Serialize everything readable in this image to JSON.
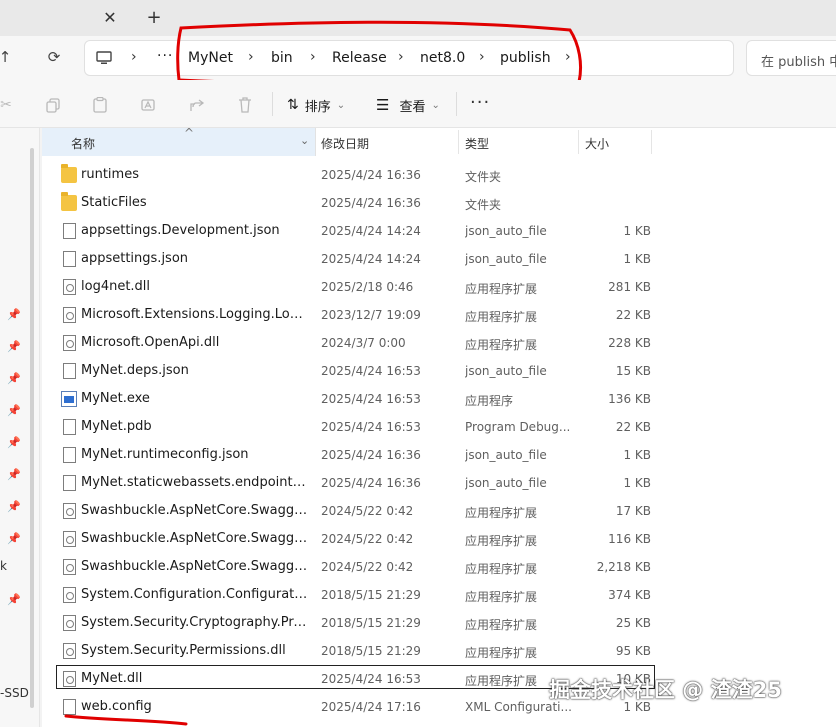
{
  "tabstrip": {
    "close_glyph": "✕",
    "new_tab_glyph": "+"
  },
  "address": {
    "crumbs": [
      "MyNet",
      "bin",
      "Release",
      "net8.0",
      "publish"
    ],
    "more_glyph": "···",
    "search_placeholder": "在 publish 中"
  },
  "commandbar": {
    "sort_label": "排序",
    "view_label": "查看",
    "more_glyph": "···"
  },
  "navpane": {
    "fragment_k": "k",
    "fragment_ssd": "-SSD"
  },
  "columns": {
    "name": "名称",
    "modified": "修改日期",
    "type": "类型",
    "size": "大小"
  },
  "files": [
    {
      "name": "runtimes",
      "date": "2025/4/24 16:36",
      "type": "文件夹",
      "size": "",
      "icon": "folder-icon"
    },
    {
      "name": "StaticFiles",
      "date": "2025/4/24 16:36",
      "type": "文件夹",
      "size": "",
      "icon": "folder-icon"
    },
    {
      "name": "appsettings.Development.json",
      "date": "2025/4/24 14:24",
      "type": "json_auto_file",
      "size": "1 KB",
      "icon": "file-icon"
    },
    {
      "name": "appsettings.json",
      "date": "2025/4/24 14:24",
      "type": "json_auto_file",
      "size": "1 KB",
      "icon": "file-icon"
    },
    {
      "name": "log4net.dll",
      "date": "2025/2/18 0:46",
      "type": "应用程序扩展",
      "size": "281 KB",
      "icon": "dll-icon"
    },
    {
      "name": "Microsoft.Extensions.Logging.Log4N...",
      "date": "2023/12/7 19:09",
      "type": "应用程序扩展",
      "size": "22 KB",
      "icon": "dll-icon"
    },
    {
      "name": "Microsoft.OpenApi.dll",
      "date": "2024/3/7 0:00",
      "type": "应用程序扩展",
      "size": "228 KB",
      "icon": "dll-icon"
    },
    {
      "name": "MyNet.deps.json",
      "date": "2025/4/24 16:53",
      "type": "json_auto_file",
      "size": "15 KB",
      "icon": "file-icon"
    },
    {
      "name": "MyNet.exe",
      "date": "2025/4/24 16:53",
      "type": "应用程序",
      "size": "136 KB",
      "icon": "exe-icon"
    },
    {
      "name": "MyNet.pdb",
      "date": "2025/4/24 16:53",
      "type": "Program Debug...",
      "size": "22 KB",
      "icon": "file-icon"
    },
    {
      "name": "MyNet.runtimeconfig.json",
      "date": "2025/4/24 16:36",
      "type": "json_auto_file",
      "size": "1 KB",
      "icon": "file-icon"
    },
    {
      "name": "MyNet.staticwebassets.endpoints.json",
      "date": "2025/4/24 16:36",
      "type": "json_auto_file",
      "size": "1 KB",
      "icon": "file-icon"
    },
    {
      "name": "Swashbuckle.AspNetCore.Swagger.dll",
      "date": "2024/5/22 0:42",
      "type": "应用程序扩展",
      "size": "17 KB",
      "icon": "dll-icon"
    },
    {
      "name": "Swashbuckle.AspNetCore.SwaggerG...",
      "date": "2024/5/22 0:42",
      "type": "应用程序扩展",
      "size": "116 KB",
      "icon": "dll-icon"
    },
    {
      "name": "Swashbuckle.AspNetCore.SwaggerUI...",
      "date": "2024/5/22 0:42",
      "type": "应用程序扩展",
      "size": "2,218 KB",
      "icon": "dll-icon"
    },
    {
      "name": "System.Configuration.ConfigurationM...",
      "date": "2018/5/15 21:29",
      "type": "应用程序扩展",
      "size": "374 KB",
      "icon": "dll-icon"
    },
    {
      "name": "System.Security.Cryptography.Protect...",
      "date": "2018/5/15 21:29",
      "type": "应用程序扩展",
      "size": "25 KB",
      "icon": "dll-icon"
    },
    {
      "name": "System.Security.Permissions.dll",
      "date": "2018/5/15 21:29",
      "type": "应用程序扩展",
      "size": "95 KB",
      "icon": "dll-icon"
    },
    {
      "name": "MyNet.dll",
      "date": "2025/4/24 16:53",
      "type": "应用程序扩展",
      "size": "10 KB",
      "icon": "dll-icon",
      "selected": true
    },
    {
      "name": "web.config",
      "date": "2025/4/24 17:16",
      "type": "XML Configurati...",
      "size": "1 KB",
      "icon": "config-file-icon"
    }
  ],
  "watermark": "掘金技术社区 @ 渣渣25"
}
